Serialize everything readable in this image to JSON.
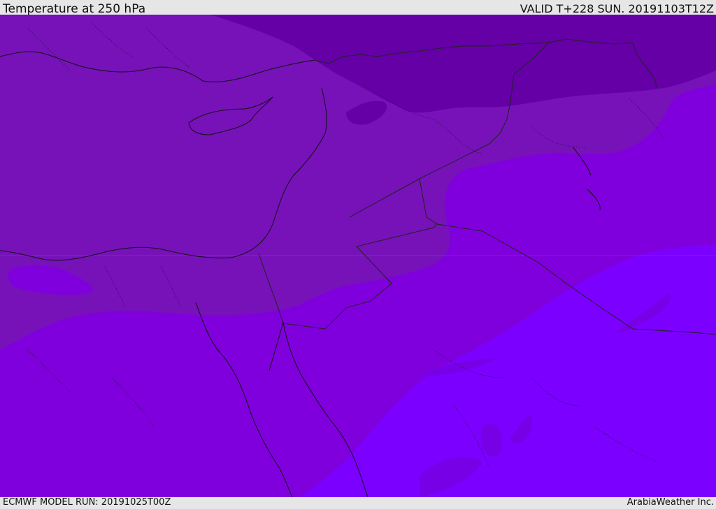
{
  "header": {
    "title": "Temperature at 250 hPa",
    "valid_time": "VALID T+228 SUN. 20191103T12Z"
  },
  "footer": {
    "model_run": "ECMWF MODEL RUN: 20191025T00Z",
    "credit": "ArabiaWeather Inc."
  },
  "map": {
    "field": "temperature",
    "colors": {
      "band_darkest": "#6400a6",
      "band_dark": "#7612b8",
      "band_mid": "#7f00dc",
      "band_light": "#7800e6",
      "band_lightest": "#7b00ff",
      "coastline": "#111111",
      "border": "#222222"
    }
  }
}
